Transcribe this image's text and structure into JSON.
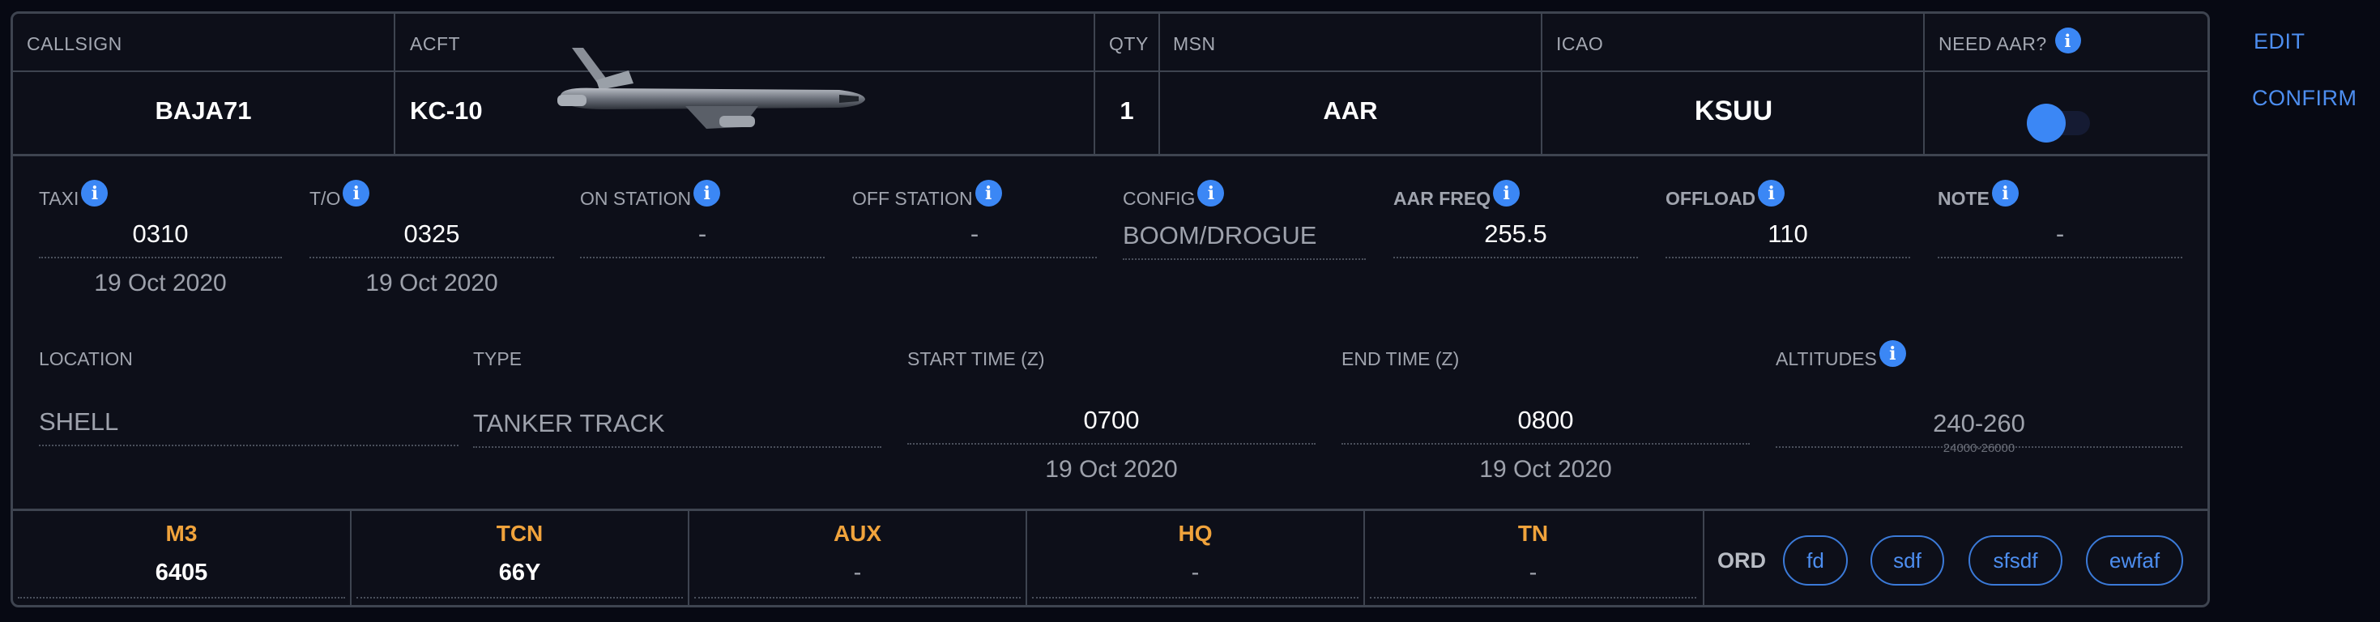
{
  "header": {
    "callsign": {
      "label": "CALLSIGN",
      "value": "BAJA71"
    },
    "acft": {
      "label": "ACFT",
      "value": "KC-10"
    },
    "qty": {
      "label": "QTY",
      "value": "1"
    },
    "msn": {
      "label": "MSN",
      "value": "AAR"
    },
    "icao": {
      "label": "ICAO",
      "value": "KSUU"
    },
    "need_aar": {
      "label": "NEED AAR?",
      "enabled": true
    }
  },
  "details": {
    "taxi": {
      "label": "TAXI",
      "value": "0310",
      "date": "19 Oct 2020"
    },
    "takeoff": {
      "label": "T/O",
      "value": "0325",
      "date": "19 Oct 2020"
    },
    "on_station": {
      "label": "ON STATION",
      "value": "-"
    },
    "off_station": {
      "label": "OFF STATION",
      "value": "-"
    },
    "config": {
      "label": "CONFIG",
      "value": "BOOM/DROGUE"
    },
    "aar_freq": {
      "label": "AAR FREQ",
      "value": "255.5"
    },
    "offload": {
      "label": "OFFLOAD",
      "value": "110"
    },
    "note": {
      "label": "NOTE",
      "value": "-"
    },
    "location": {
      "label": "LOCATION",
      "value": "SHELL"
    },
    "type": {
      "label": "TYPE",
      "value": "TANKER TRACK"
    },
    "start_time": {
      "label": "START TIME (Z)",
      "value": "0700",
      "date": "19 Oct 2020"
    },
    "end_time": {
      "label": "END TIME (Z)",
      "value": "0800",
      "date": "19 Oct 2020"
    },
    "altitudes": {
      "label": "ALTITUDES",
      "value": "240-260",
      "sub": "24000-26000"
    }
  },
  "bottom": {
    "cells": [
      {
        "label": "M3",
        "value": "6405"
      },
      {
        "label": "TCN",
        "value": "66Y"
      },
      {
        "label": "AUX",
        "value": "-"
      },
      {
        "label": "HQ",
        "value": "-"
      },
      {
        "label": "TN",
        "value": "-"
      }
    ],
    "ord_label": "ORD",
    "ord_pills": [
      "fd",
      "sdf",
      "sfsdf",
      "ewfaf"
    ]
  },
  "actions": {
    "edit": "EDIT",
    "confirm": "CONFIRM"
  },
  "icons": {
    "info": "info-icon",
    "aircraft": "kc10-aircraft-image"
  },
  "colors": {
    "accent": "#3b87f5",
    "orange": "#f0a33c",
    "background": "#0d0f19",
    "border": "#3e4450"
  }
}
